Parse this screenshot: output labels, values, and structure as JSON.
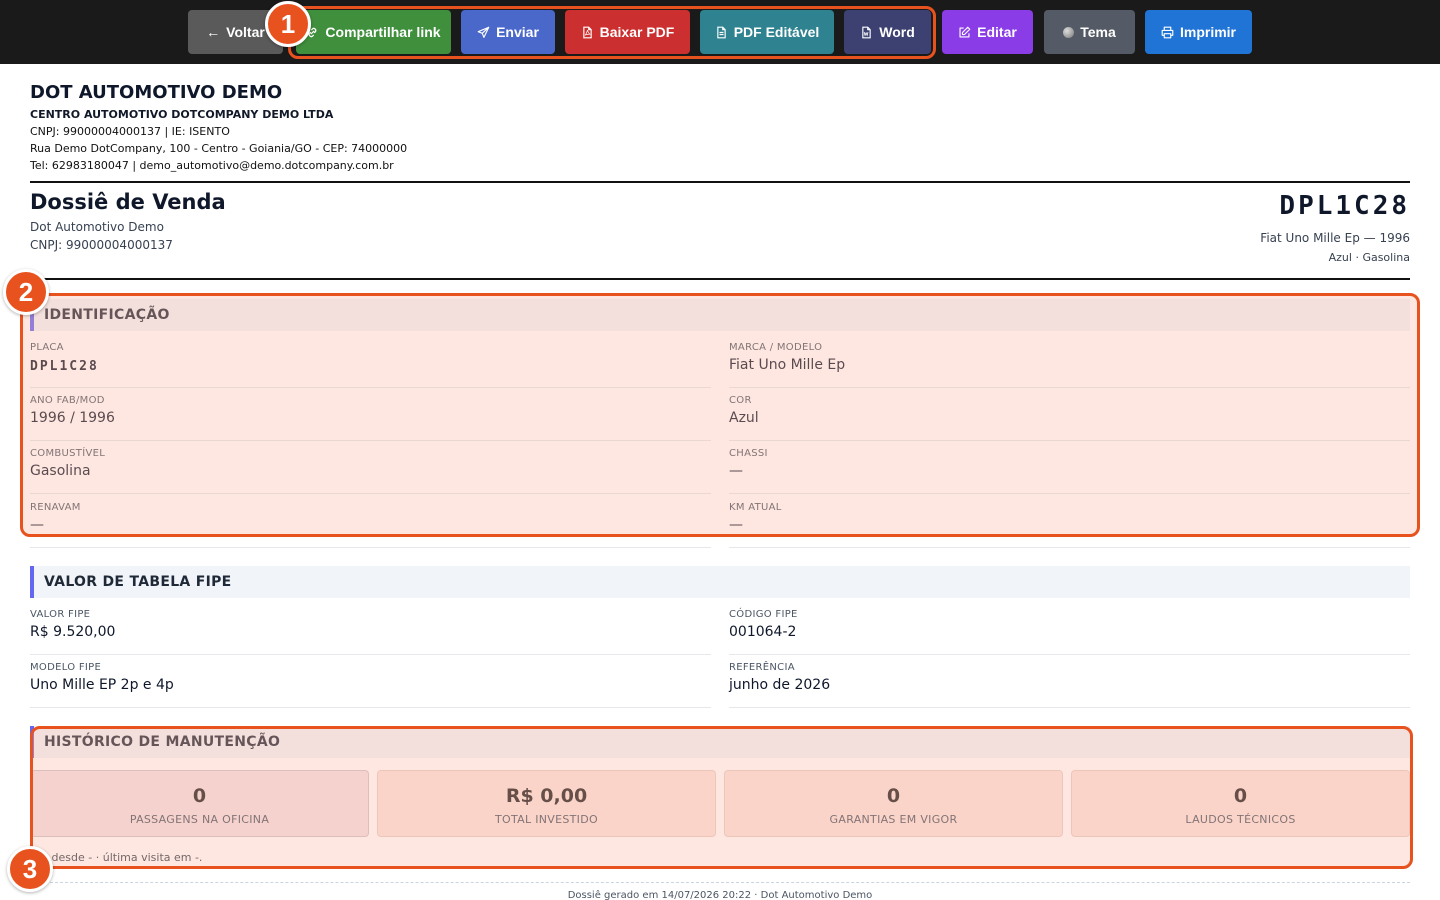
{
  "toolbar": {
    "voltar": "Voltar",
    "compartilhar": "Compartilhar link",
    "enviar": "Enviar",
    "baixar_pdf": "Baixar PDF",
    "pdf_editavel": "PDF Editável",
    "word": "Word",
    "editar": "Editar",
    "tema": "Tema",
    "imprimir": "Imprimir"
  },
  "company": {
    "name": "DOT AUTOMOTIVO DEMO",
    "legal_name": "CENTRO AUTOMOTIVO DOTCOMPANY DEMO LTDA",
    "ids_line": "CNPJ: 99000004000137  |  IE: ISENTO",
    "address_line": "Rua Demo DotCompany, 100 - Centro - Goiania/GO - CEP: 74000000",
    "contact_line": "Tel: 62983180047  |  demo_automotivo@demo.dotcompany.com.br"
  },
  "document": {
    "title": "Dossiê de Venda",
    "issuer": "Dot Automotivo Demo",
    "issuer_cnpj": "CNPJ: 99000004000137",
    "plate": "DPL1C28",
    "vehicle_line": "Fiat Uno Mille Ep — 1996",
    "vehicle_sub": "Azul · Gasolina"
  },
  "identificacao": {
    "title": "IDENTIFICAÇÃO",
    "placa_label": "PLACA",
    "placa_value": "DPL1C28",
    "marca_label": "MARCA / MODELO",
    "marca_value": "Fiat Uno Mille Ep",
    "ano_label": "ANO FAB/MOD",
    "ano_value": "1996 / 1996",
    "cor_label": "COR",
    "cor_value": "Azul",
    "combustivel_label": "COMBUSTÍVEL",
    "combustivel_value": "Gasolina",
    "chassi_label": "CHASSI",
    "chassi_value": "—",
    "renavam_label": "RENAVAM",
    "renavam_value": "—",
    "km_label": "KM ATUAL",
    "km_value": "—"
  },
  "fipe": {
    "title": "VALOR DE TABELA FIPE",
    "valor_label": "VALOR FIPE",
    "valor_value": "R$ 9.520,00",
    "codigo_label": "CÓDIGO FIPE",
    "codigo_value": "001064-2",
    "modelo_label": "MODELO FIPE",
    "modelo_value": "Uno Mille EP 2p e 4p",
    "referencia_label": "REFERÊNCIA",
    "referencia_value": "junho de 2026"
  },
  "historico": {
    "title": "HISTÓRICO DE MANUTENÇÃO",
    "stats": [
      {
        "value": "0",
        "label": "PASSAGENS NA OFICINA"
      },
      {
        "value": "R$ 0,00",
        "label": "TOTAL INVESTIDO"
      },
      {
        "value": "0",
        "label": "GARANTIAS EM VIGOR"
      },
      {
        "value": "0",
        "label": "LAUDOS TÉCNICOS"
      }
    ],
    "note": "nte desde - · última visita em -."
  },
  "footer": "Dossiê gerado em 14/07/2026 20:22 · Dot Automotivo Demo",
  "annotations": [
    "1",
    "2",
    "3"
  ],
  "colors": {
    "highlight": "#e8521f",
    "section_accent": "#6366f1"
  }
}
